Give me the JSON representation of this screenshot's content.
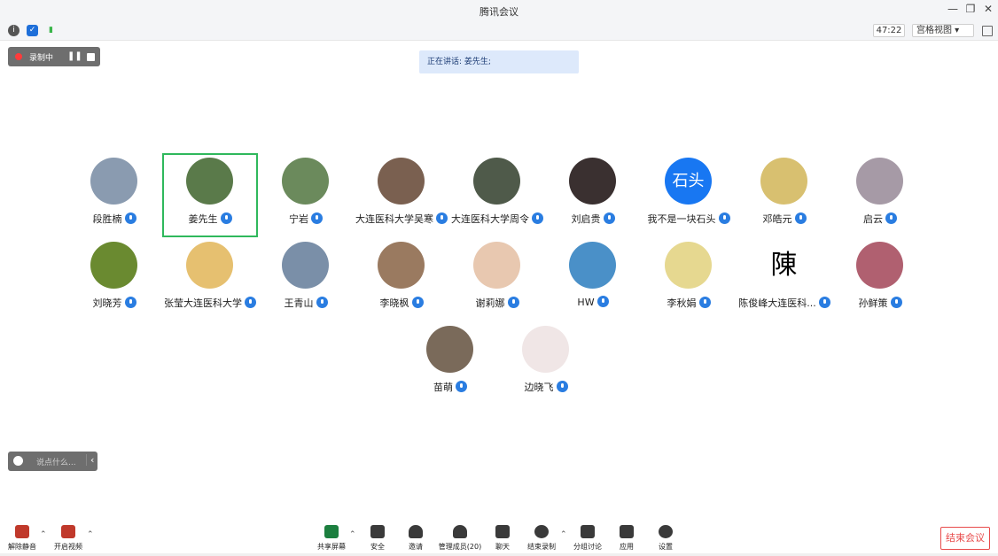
{
  "window": {
    "title": "腾讯会议"
  },
  "toolbar": {
    "timer": "47:22",
    "grid_view": "宫格视图 ▾"
  },
  "recording": {
    "label": "录制中"
  },
  "speaking": {
    "text": "正在讲话: 姜先生;"
  },
  "participants": [
    {
      "name": "段胜楠"
    },
    {
      "name": "姜先生",
      "active": true
    },
    {
      "name": "宁岩"
    },
    {
      "name": "大连医科大学吴寒"
    },
    {
      "name": "大连医科大学周令"
    },
    {
      "name": "刘启贵"
    },
    {
      "name": "我不是一块石头",
      "avatar_text": "石头"
    },
    {
      "name": "邓皓元"
    },
    {
      "name": "启云"
    },
    {
      "name": "刘晓芳"
    },
    {
      "name": "张莹大连医科大学"
    },
    {
      "name": "王青山"
    },
    {
      "name": "李晓枫"
    },
    {
      "name": "谢莉娜"
    },
    {
      "name": "HW"
    },
    {
      "name": "李秋娟"
    },
    {
      "name": "陈俊峰大连医科...",
      "avatar_text": "陳"
    },
    {
      "name": "孙鲜策"
    },
    {
      "name": "苗萌"
    },
    {
      "name": "边晓飞"
    }
  ],
  "chat": {
    "placeholder": "说点什么..."
  },
  "bottom": {
    "unmute": "解除静音",
    "start_video": "开启视频",
    "share_screen": "共享屏幕",
    "security": "安全",
    "invite": "邀请",
    "manage_members": "管理成员(20)",
    "chat": "聊天",
    "end_recording": "结束录制",
    "breakout": "分组讨论",
    "apps": "应用",
    "settings": "设置",
    "end_meeting": "结束会议"
  },
  "colors": {
    "accent": "#2a7de1",
    "speaking_border": "#2fb85c",
    "end_red": "#e84a4a"
  }
}
